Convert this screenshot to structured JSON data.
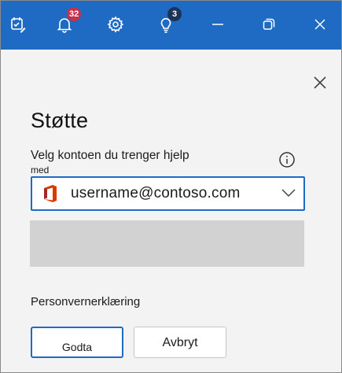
{
  "titlebar": {
    "notifications_count": "32",
    "tips_count": "3",
    "accent_color": "#1f6ac2"
  },
  "icons": {
    "toolbar": [
      "tasks-icon",
      "bell-icon",
      "gear-icon",
      "lightbulb-icon",
      "minimize-icon",
      "restore-icon",
      "close-icon"
    ],
    "panel": [
      "close-icon",
      "info-icon",
      "office-icon",
      "chevron-down-icon"
    ]
  },
  "panel": {
    "title": "Støtte",
    "account_label": "Velg kontoen du trenger hjelp",
    "account_label_continuation": "med",
    "account_select": {
      "value": "username@contoso.com"
    },
    "privacy_label": "Personvernerklæring",
    "accept_button": "Godta",
    "cancel_button": "Avbryt"
  }
}
